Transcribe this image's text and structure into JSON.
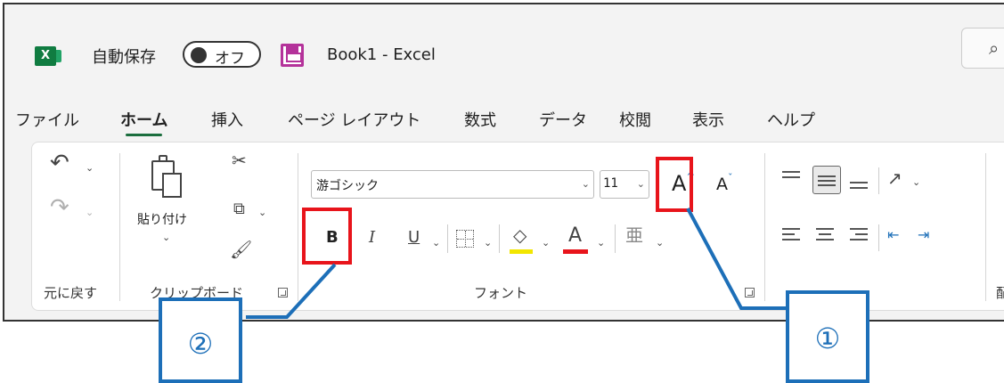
{
  "titlebar": {
    "app_logo": "X",
    "autosave_label": "自動保存",
    "autosave_toggle": "オフ",
    "document_title": "Book1  -  Excel",
    "search_icon": "⌕"
  },
  "tabs": [
    {
      "label": "ファイル"
    },
    {
      "label": "ホーム"
    },
    {
      "label": "挿入"
    },
    {
      "label": "ページ レイアウト"
    },
    {
      "label": "数式"
    },
    {
      "label": "データ"
    },
    {
      "label": "校閲"
    },
    {
      "label": "表示"
    },
    {
      "label": "ヘルプ"
    }
  ],
  "ribbon": {
    "undo": {
      "label": "元に戻す"
    },
    "clipboard": {
      "label": "クリップボード",
      "paste_label": "貼り付け"
    },
    "font": {
      "label": "フォント",
      "font_name": "游ゴシック",
      "font_size": "11",
      "grow_glyph": "A",
      "shrink_glyph": "A",
      "bold_glyph": "B",
      "italic_glyph": "I",
      "underline_glyph": "U",
      "font_color_glyph": "A"
    },
    "alignment": {
      "label": "配"
    }
  },
  "callouts": {
    "one": "①",
    "two": "②"
  },
  "colors": {
    "highlight_red": "#e8141b",
    "callout_blue": "#1d6fb8",
    "excel_green": "#107c41",
    "fill_yellow": "#f2e600",
    "font_red": "#e8141b"
  }
}
